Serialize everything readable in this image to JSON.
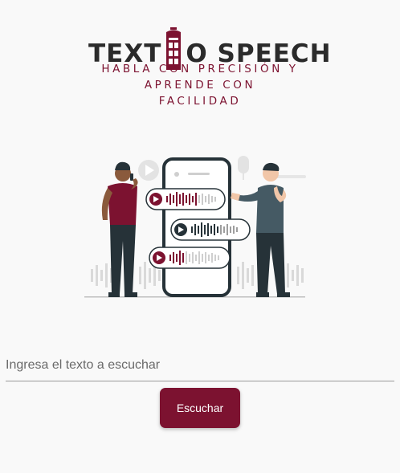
{
  "logo": {
    "title_left": "TEXT",
    "title_right": "O SPEECH",
    "subtitle_line1": "HABLA CON PRECISIÓN Y",
    "subtitle_line2": "APRENDE CON",
    "subtitle_line3": "FACILIDAD"
  },
  "input": {
    "placeholder": "Ingresa el texto a escuchar",
    "value": ""
  },
  "button": {
    "label": "Escuchar"
  },
  "colors": {
    "brand": "#7c1230",
    "dark": "#2b2b2b",
    "background": "#f9f9f9"
  },
  "icons": [
    "phone-booth-icon",
    "play-icon"
  ]
}
